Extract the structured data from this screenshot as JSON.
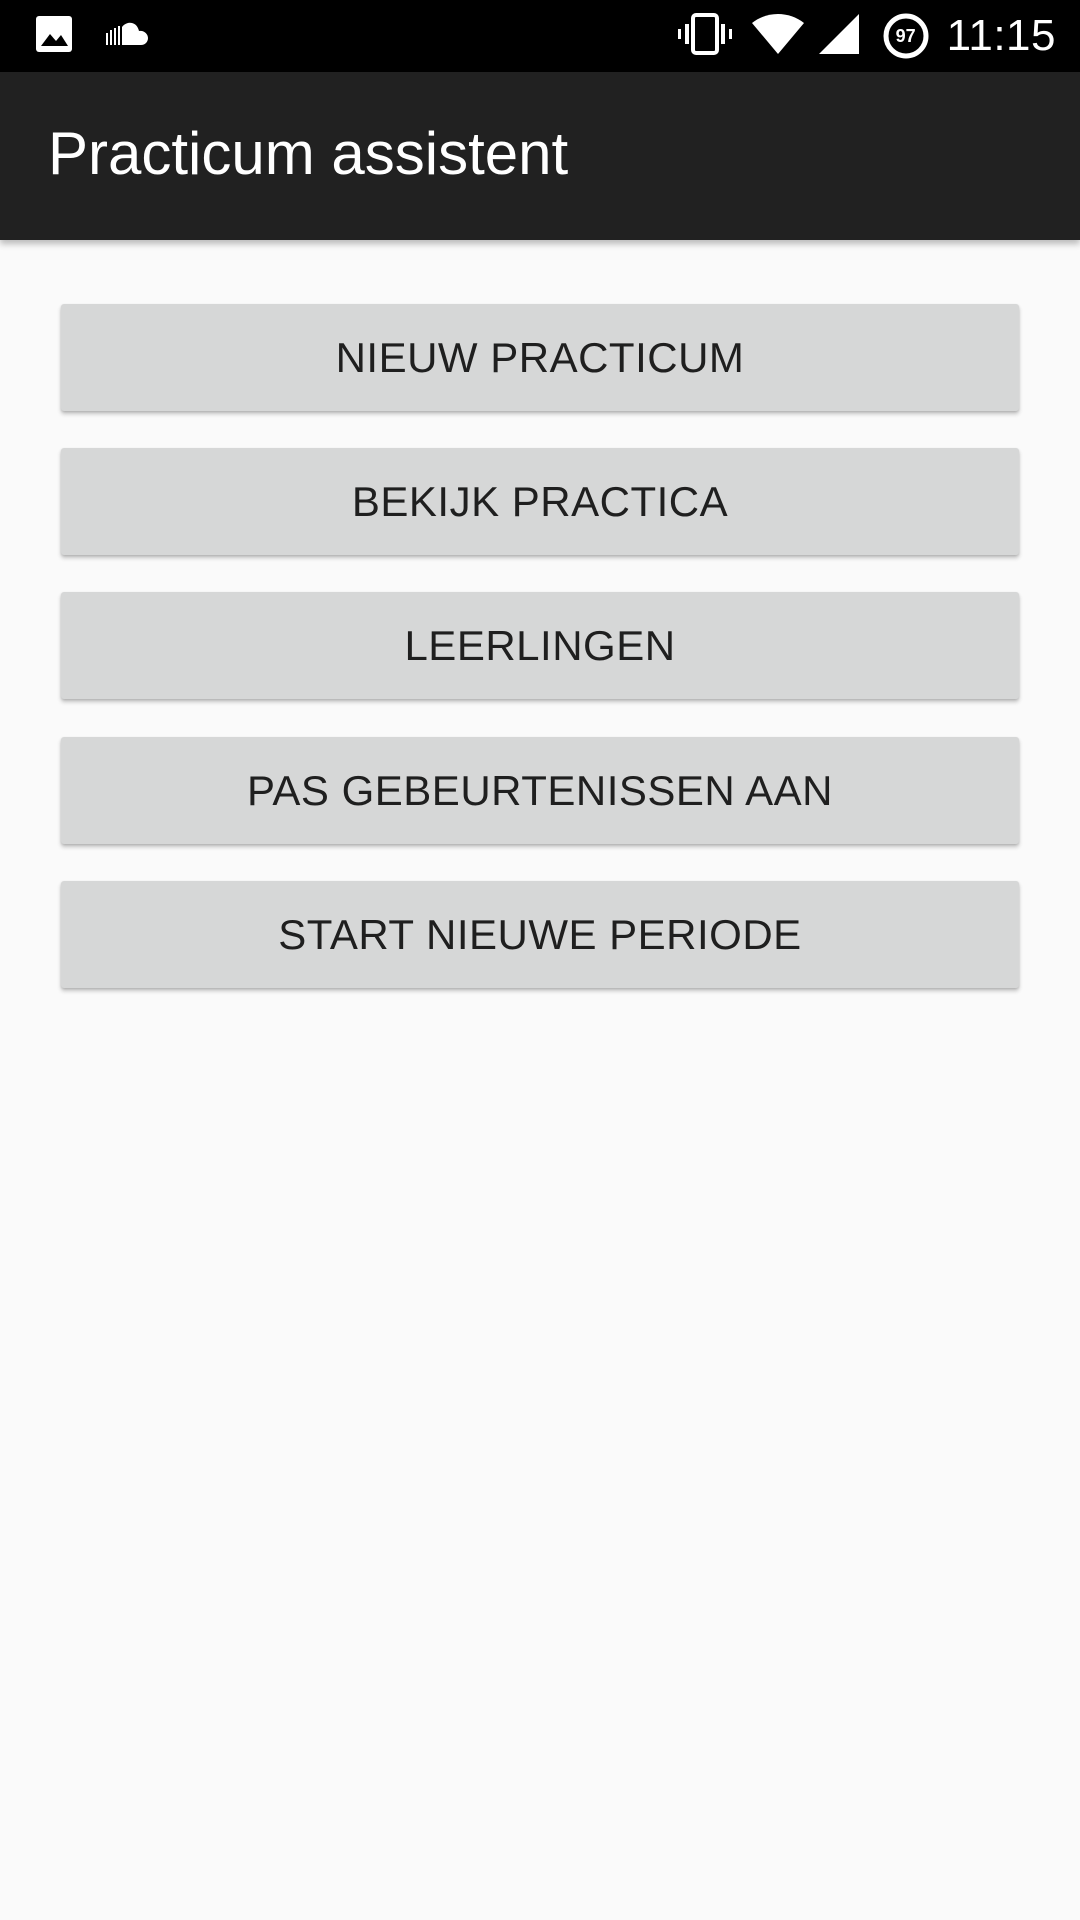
{
  "status_bar": {
    "left_icons": [
      "image-icon",
      "cloud-icon"
    ],
    "right_icons": [
      "vibrate-icon",
      "wifi-icon",
      "cell-signal-icon",
      "battery-icon"
    ],
    "battery_level": "97",
    "time": "11:15"
  },
  "app_bar": {
    "title": "Practicum assistent",
    "background_color": "#212121"
  },
  "main": {
    "buttons": [
      {
        "label": "NIEUW PRACTICUM"
      },
      {
        "label": "BEKIJK PRACTICA"
      },
      {
        "label": "LEERLINGEN"
      },
      {
        "label": "PAS GEBEURTENISSEN AAN"
      },
      {
        "label": "START NIEUWE PERIODE"
      }
    ]
  },
  "colors": {
    "status_bar": "#000000",
    "background": "#fafafa",
    "button": "#d6d7d7",
    "button_text": "#1f1f1f"
  }
}
